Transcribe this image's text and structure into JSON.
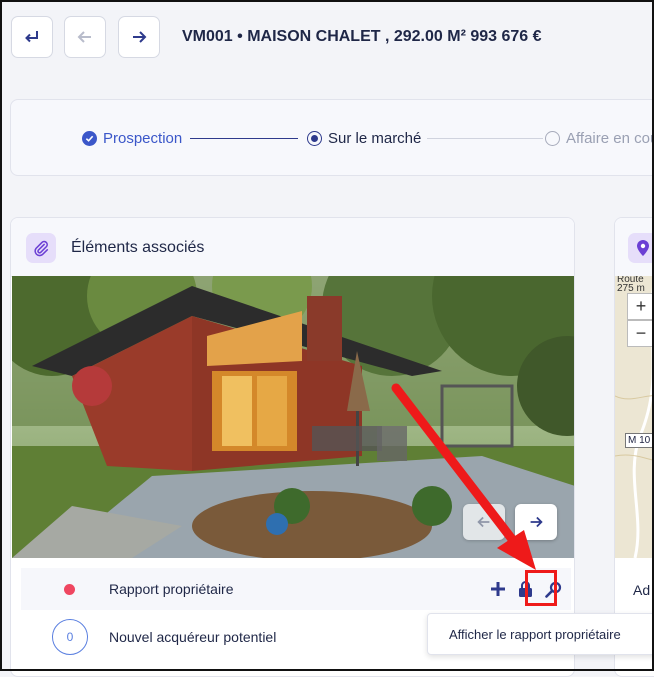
{
  "header": {
    "title": "VM001 • MAISON CHALET , 292.00 M² 993 676 €",
    "buttons": [
      {
        "name": "return-icon"
      },
      {
        "name": "arrow-left-icon"
      },
      {
        "name": "arrow-right-icon"
      }
    ]
  },
  "stepper": {
    "steps": [
      {
        "label": "Prospection",
        "state": "done"
      },
      {
        "label": "Sur le marché",
        "state": "current"
      },
      {
        "label": "Affaire en cours",
        "state": "todo"
      }
    ]
  },
  "associated": {
    "title": "Éléments associés",
    "icon": "paperclip-icon",
    "photo_nav": {
      "prev": "arrow-left-icon",
      "next": "arrow-right-icon"
    },
    "items": [
      {
        "label": "Rapport propriétaire",
        "status_color": "#ef4660",
        "actions": [
          "plus-icon",
          "lock-icon",
          "magnifier-icon"
        ]
      },
      {
        "label": "Nouvel acquéreur potentiel",
        "count": "0"
      }
    ]
  },
  "map": {
    "icon": "location-pin-icon",
    "labels": {
      "top": "Route",
      "elevation": "275 m",
      "road": "M 10",
      "footer": "Ad"
    },
    "zoom": {
      "in": "+",
      "out": "−"
    }
  },
  "tooltip": {
    "text": "Afficher le rapport propriétaire"
  },
  "colors": {
    "accent": "#2e3a8c",
    "step_done": "#3b57c9",
    "status_red": "#ef4660",
    "annotation_red": "#ee1a1a",
    "purple_icon_bg": "#e6defa"
  }
}
